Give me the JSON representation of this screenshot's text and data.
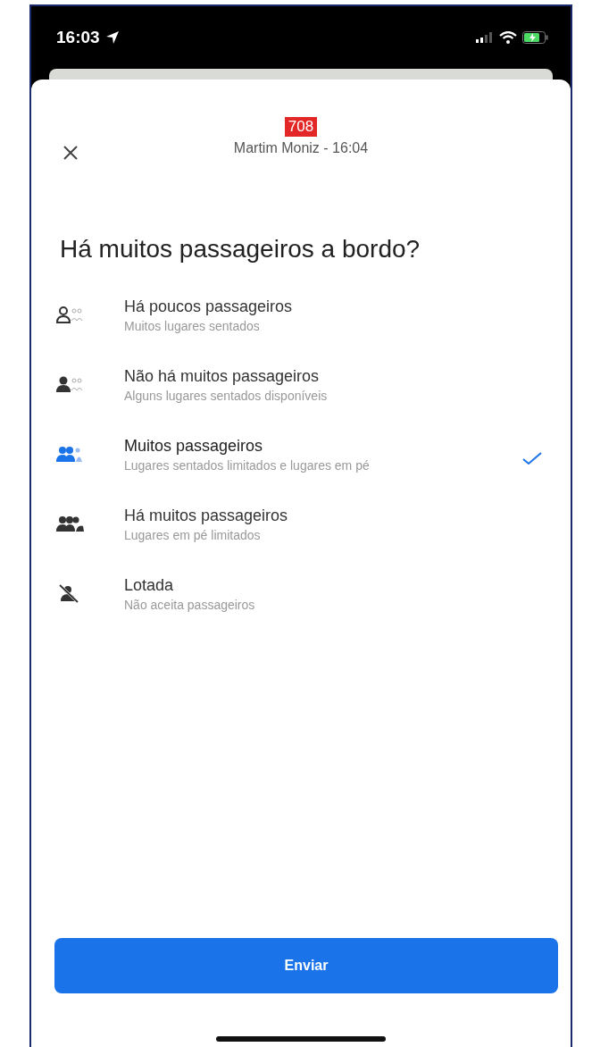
{
  "status_bar": {
    "time": "16:03"
  },
  "header": {
    "route_badge": "708",
    "subtitle": "Martim Moniz - 16:04"
  },
  "question": "Há muitos passageiros a bordo?",
  "options": [
    {
      "kind": "few",
      "title": "Há poucos passageiros",
      "description": "Muitos lugares sentados",
      "selected": false
    },
    {
      "kind": "some",
      "title": "Não há muitos passageiros",
      "description": "Alguns lugares sentados disponíveis",
      "selected": false
    },
    {
      "kind": "many",
      "title": "Muitos passageiros",
      "description": "Lugares sentados limitados e lugares em pé",
      "selected": true
    },
    {
      "kind": "crowded",
      "title": "Há muitos passageiros",
      "description": "Lugares em pé limitados",
      "selected": false
    },
    {
      "kind": "full",
      "title": "Lotada",
      "description": "Não aceita passageiros",
      "selected": false
    }
  ],
  "submit_button": "Enviar"
}
